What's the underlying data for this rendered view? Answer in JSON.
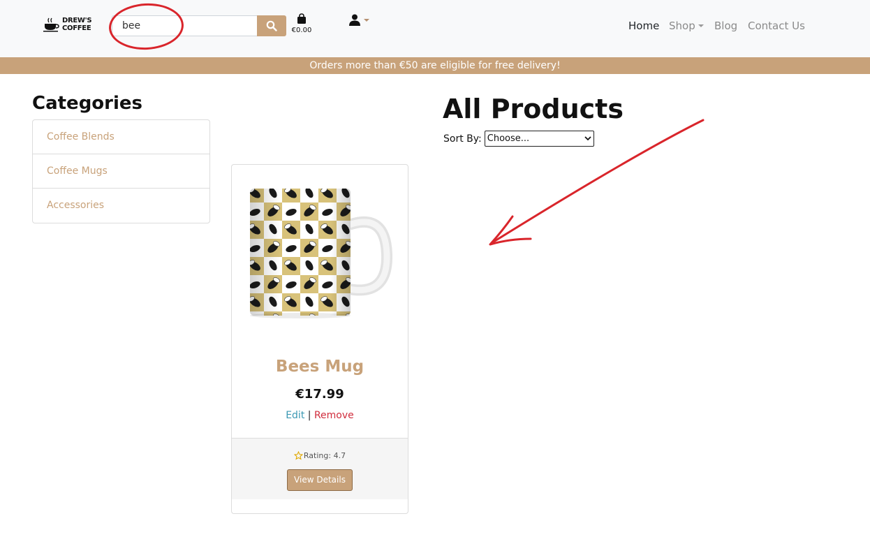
{
  "brand": {
    "logo_text_line1": "DREW'S",
    "logo_text_line2": "COFFEE"
  },
  "search": {
    "value": "bee",
    "placeholder": ""
  },
  "bag": {
    "total": "€0.00"
  },
  "nav": {
    "home": "Home",
    "shop": "Shop",
    "blog": "Blog",
    "contact": "Contact Us"
  },
  "banner": {
    "text": "Orders more than €50 are eligible for free delivery!"
  },
  "categories": {
    "title": "Categories",
    "items": [
      "Coffee Blends",
      "Coffee Mugs",
      "Accessories"
    ]
  },
  "products": {
    "heading": "All Products",
    "sort_label": "Sort By:",
    "sort_selected": "Choose..."
  },
  "card": {
    "name": "Bees Mug",
    "price": "€17.99",
    "edit": "Edit",
    "separator": "|",
    "remove": "Remove",
    "rating_label": "Rating: 4.7",
    "view_button": "View Details"
  },
  "colors": {
    "accent": "#c8a27a",
    "annotation": "#d9252b",
    "edit": "#3a98b3",
    "remove": "#d02d3d"
  },
  "icons": [
    "coffee-cup-icon",
    "search-icon",
    "shopping-bag-icon",
    "user-icon",
    "chevron-down-icon",
    "star-icon"
  ]
}
